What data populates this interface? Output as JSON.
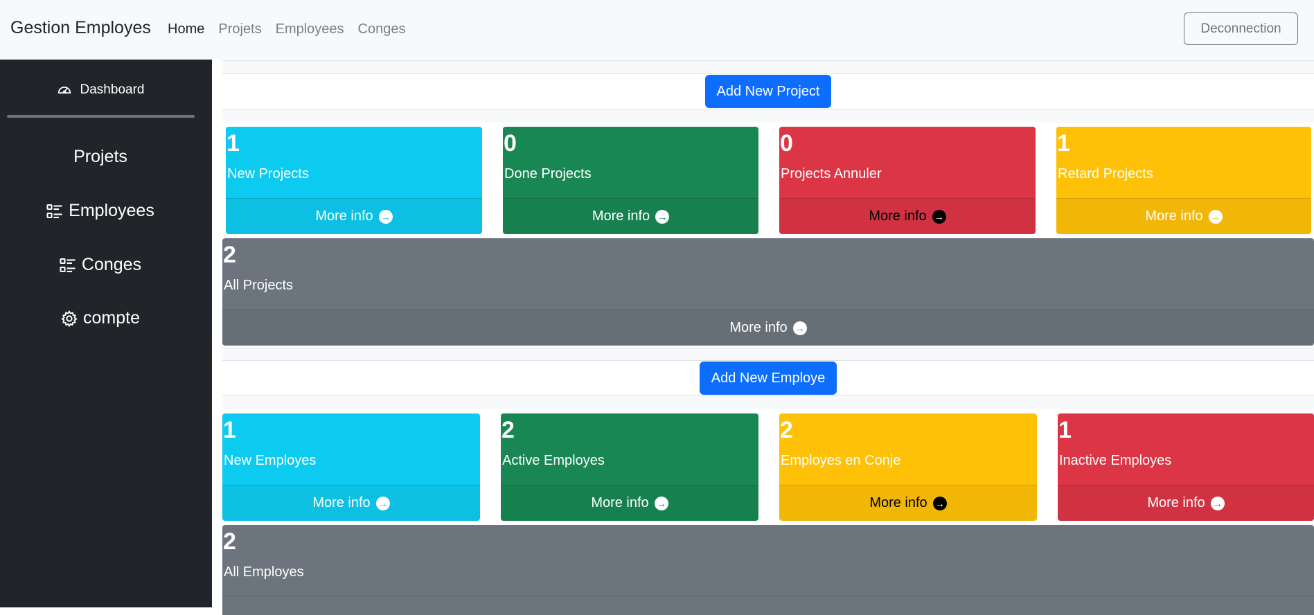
{
  "header": {
    "brand": "Gestion Employes",
    "nav": [
      "Home",
      "Projets",
      "Employees",
      "Conges"
    ],
    "logout_label": "Deconnection"
  },
  "sidebar": {
    "dashboard_label": "Dashboard",
    "items": [
      {
        "label": "Projets",
        "icon": "none"
      },
      {
        "label": "Employees",
        "icon": "checklist-icon"
      },
      {
        "label": "Conges",
        "icon": "checklist-icon"
      },
      {
        "label": "compte",
        "icon": "gear-icon"
      }
    ]
  },
  "projects": {
    "add_label": "Add New Project",
    "cards": [
      {
        "count": "1",
        "label": "New Projects",
        "more": "More info",
        "color": "#0dcaf0"
      },
      {
        "count": "0",
        "label": "Done Projects",
        "more": "More info",
        "color": "#198754"
      },
      {
        "count": "0",
        "label": "Projects Annuler",
        "more": "More info",
        "color": "#dc3545"
      },
      {
        "count": "1",
        "label": "Retard Projects",
        "more": "More info",
        "color": "#ffc107"
      }
    ],
    "all": {
      "count": "2",
      "label": "All Projects",
      "more": "More info",
      "color": "#6c757d"
    }
  },
  "employes": {
    "add_label": "Add New Employe",
    "cards": [
      {
        "count": "1",
        "label": "New Employes",
        "more": "More info",
        "color": "#0dcaf0"
      },
      {
        "count": "2",
        "label": "Active Employes",
        "more": "More info",
        "color": "#198754"
      },
      {
        "count": "2",
        "label": "Employes en Conje",
        "more": "More info",
        "color": "#ffc107"
      },
      {
        "count": "1",
        "label": "Inactive Employes",
        "more": "More info",
        "color": "#dc3545"
      }
    ],
    "all": {
      "count": "2",
      "label": "All Employes",
      "color": "#6c757d"
    }
  }
}
